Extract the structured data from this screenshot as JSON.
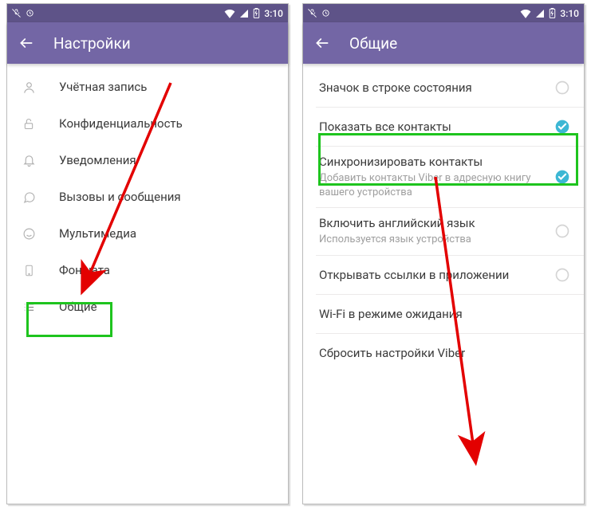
{
  "status": {
    "time": "3:10",
    "wifi_icon": "wifi",
    "signal": "signal",
    "battery": "battery",
    "mic_muted": "mic-off",
    "alarm": "alarm"
  },
  "left": {
    "title": "Настройки",
    "items": [
      {
        "icon": "user",
        "label": "Учётная запись"
      },
      {
        "icon": "lock",
        "label": "Конфиденциальность"
      },
      {
        "icon": "bell",
        "label": "Уведомления"
      },
      {
        "icon": "chat",
        "label": "Вызовы и сообщения"
      },
      {
        "icon": "smile",
        "label": "Мультимедиа"
      },
      {
        "icon": "phone",
        "label": "Фон чата"
      },
      {
        "icon": "list",
        "label": "Общие"
      }
    ]
  },
  "right": {
    "title": "Общие",
    "items": [
      {
        "label": "Значок в строке состояния",
        "sub": "",
        "checked": "off"
      },
      {
        "label": "Показать все контакты",
        "sub": "",
        "checked": "on"
      },
      {
        "label": "Синхронизировать контакты",
        "sub": "Добавить контакты Viber в адресную книгу вашего устройства",
        "checked": "on"
      },
      {
        "label": "Включить английский язык",
        "sub": "Используется язык устройства",
        "checked": "off"
      },
      {
        "label": "Открывать ссылки в приложении",
        "sub": "",
        "checked": "off"
      },
      {
        "label": "Wi-Fi в режиме ожидания",
        "sub": "",
        "checked": "none"
      },
      {
        "label": "Сбросить настройки Viber",
        "sub": "",
        "checked": "none"
      }
    ]
  }
}
